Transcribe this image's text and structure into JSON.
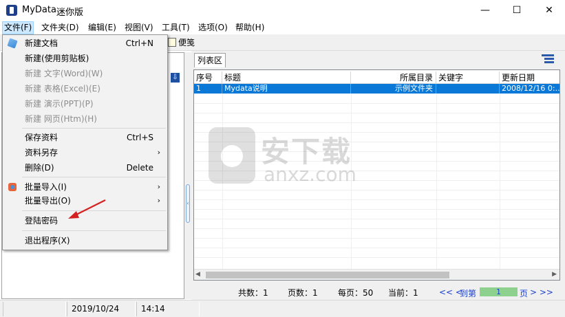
{
  "window": {
    "title": "MyData",
    "subtitle": "迷你版",
    "minimize": "—",
    "maximize": "☐",
    "close": "✕"
  },
  "menubar": [
    {
      "label": "文件(F)"
    },
    {
      "label": "文件夹(D)"
    },
    {
      "label": "编辑(E)"
    },
    {
      "label": "视图(V)"
    },
    {
      "label": "工具(T)"
    },
    {
      "label": "选项(O)"
    },
    {
      "label": "帮助(H)"
    }
  ],
  "toolbar": {
    "note_label": "便笺"
  },
  "file_menu": {
    "items": [
      {
        "label": "新建文档",
        "shortcut": "Ctrl+N",
        "enabled": true,
        "icon": "new-doc-icon"
      },
      {
        "label": "新建(使用剪贴板)",
        "shortcut": "",
        "enabled": true
      },
      {
        "label": "新建 文字(Word)(W)",
        "shortcut": "",
        "enabled": false
      },
      {
        "label": "新建 表格(Excel)(E)",
        "shortcut": "",
        "enabled": false
      },
      {
        "label": "新建 演示(PPT)(P)",
        "shortcut": "",
        "enabled": false
      },
      {
        "label": "新建 网页(Htm)(H)",
        "shortcut": "",
        "enabled": false
      },
      {
        "label": "保存资料",
        "shortcut": "Ctrl+S",
        "enabled": true
      },
      {
        "label": "资料另存",
        "shortcut": "",
        "enabled": true,
        "submenu": true
      },
      {
        "label": "删除(D)",
        "shortcut": "Delete",
        "enabled": true
      },
      {
        "label": "批量导入(I)",
        "shortcut": "",
        "enabled": true,
        "submenu": true,
        "icon": "import-icon"
      },
      {
        "label": "批量导出(O)",
        "shortcut": "",
        "enabled": true,
        "submenu": true
      },
      {
        "label": "登陆密码",
        "shortcut": "",
        "enabled": true
      },
      {
        "label": "退出程序(X)",
        "shortcut": "",
        "enabled": true
      }
    ]
  },
  "list_view": {
    "tab_label": "列表区",
    "columns": [
      "序号",
      "标题",
      "所属目录",
      "关键字",
      "更新日期"
    ],
    "rows": [
      {
        "index": "1",
        "title": "Mydata说明",
        "folder": "示例文件夹",
        "keywords": "",
        "updated": "2008/12/16 0:..."
      }
    ]
  },
  "pager": {
    "total": "共数：1",
    "pages": "页数：1",
    "per_page": "每页：50",
    "current": "当前：1",
    "prev": "<< <",
    "goto_label": "到第",
    "page_value": "1",
    "page_suffix": "页",
    "next": "> >>"
  },
  "statusbar": {
    "date": "2019/10/24",
    "time": "14:14"
  },
  "watermark": {
    "cn": "安下载",
    "en": "anxz.com"
  },
  "colors": {
    "selection": "#0a78d7",
    "menu_active": "#cce8ff",
    "arrow": "#d42020",
    "pager_link": "#1a3fd0"
  }
}
